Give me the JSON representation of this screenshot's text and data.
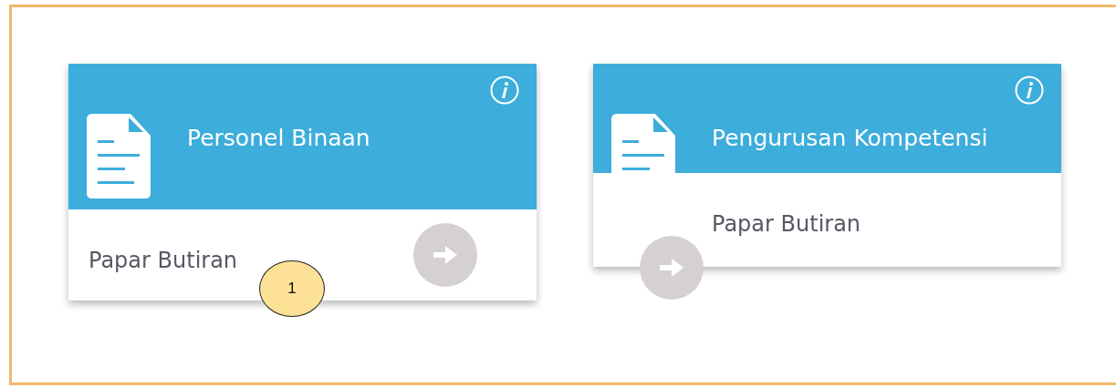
{
  "cards": [
    {
      "kind": "full",
      "title": "Personel Binaan",
      "link": "Papar Butiran"
    },
    {
      "kind": "compact",
      "title": "Pengurusan Kompetensi",
      "link": "Papar Butiran"
    }
  ],
  "callouts": [
    {
      "label": "1"
    }
  ]
}
